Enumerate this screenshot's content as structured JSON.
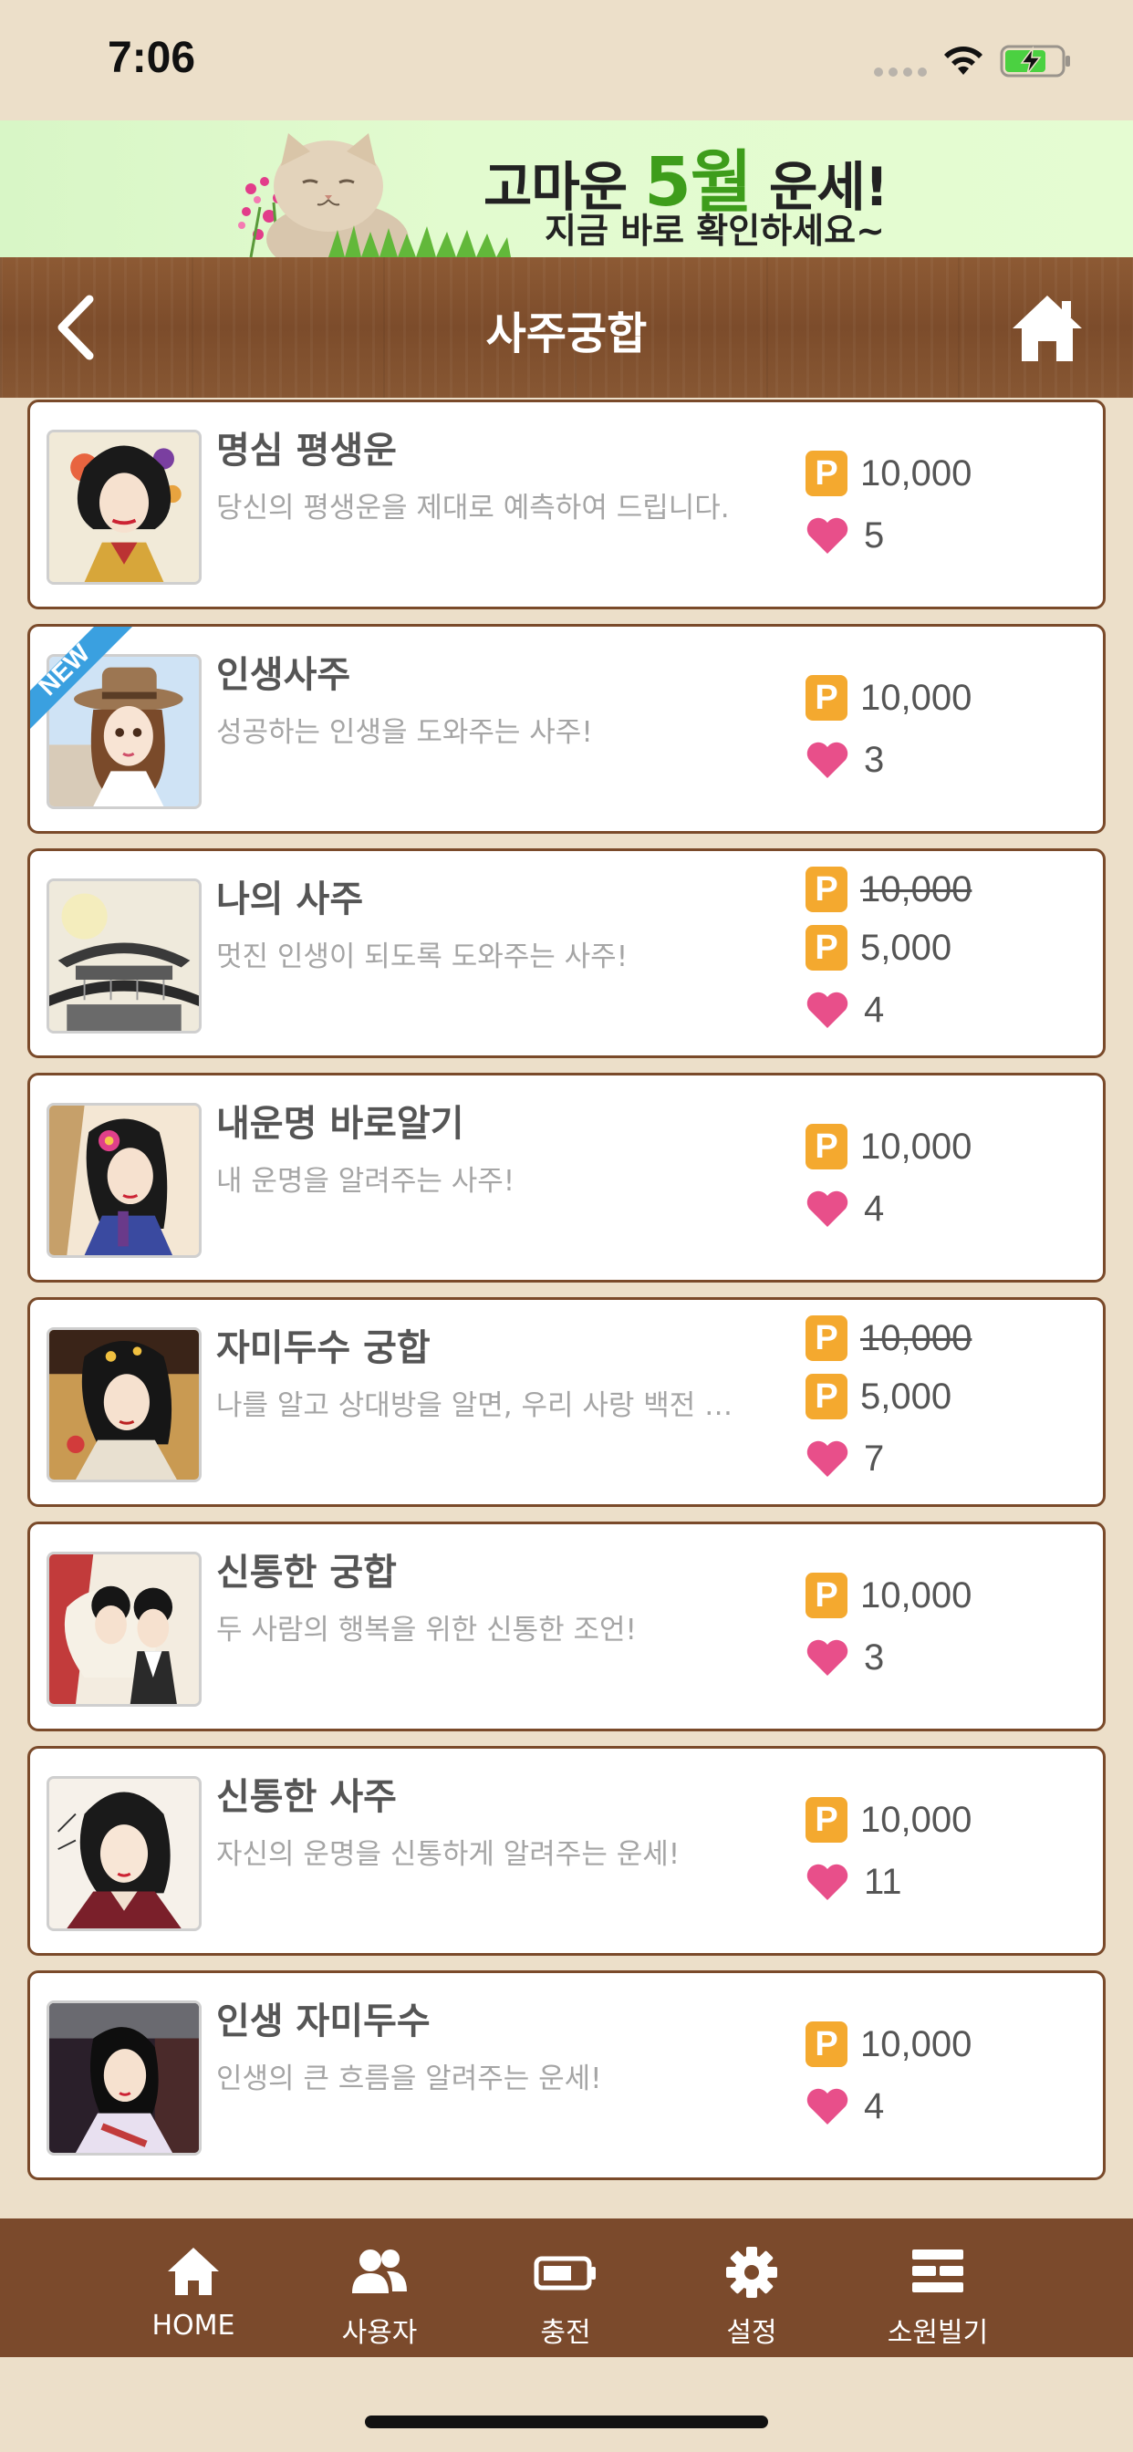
{
  "status_bar": {
    "time": "7:06"
  },
  "banner": {
    "title_prefix": "고마운 ",
    "title_highlight": "5월",
    "title_suffix": " 운세!",
    "subtitle": "지금 바로 확인하세요~"
  },
  "header": {
    "title": "사주궁합"
  },
  "items": [
    {
      "title": "명심 평생운",
      "desc": "당신의 평생운을 제대로 예측하여 드립니다.",
      "price": "10,000",
      "likes": "5",
      "art": "lady-flowers"
    },
    {
      "title": "인생사주",
      "desc": "성공하는 인생을 도와주는 사주!",
      "price": "10,000",
      "likes": "3",
      "badge": "NEW",
      "art": "girl-hat"
    },
    {
      "title": "나의 사주",
      "desc": "멋진 인생이 되도록 도와주는 사주!",
      "original_price": "10,000",
      "price": "5,000",
      "likes": "4",
      "art": "palace"
    },
    {
      "title": "내운명 바로알기",
      "desc": "내 운명을 알려주는 사주!",
      "price": "10,000",
      "likes": "4",
      "art": "lady-pink"
    },
    {
      "title": "자미두수 궁합",
      "desc": "나를 알고 상대방을 알면, 우리 사랑 백전 백승!",
      "original_price": "10,000",
      "price": "5,000",
      "likes": "7",
      "art": "lady-dark"
    },
    {
      "title": "신통한 궁합",
      "desc": "두 사람의 행복을 위한 신통한 조언!",
      "price": "10,000",
      "likes": "3",
      "art": "couple"
    },
    {
      "title": "신통한 사주",
      "desc": "자신의 운명을 신통하게 알려주는 운세!",
      "price": "10,000",
      "likes": "11",
      "art": "lady-red"
    },
    {
      "title": "인생 자미두수",
      "desc": "인생의 큰 흐름을 알려주는 운세!",
      "price": "10,000",
      "likes": "4",
      "art": "lady-night"
    }
  ],
  "price_badge": "P",
  "tabs": [
    {
      "label": "HOME",
      "icon": "home-icon"
    },
    {
      "label": "사용자",
      "icon": "users-icon"
    },
    {
      "label": "충전",
      "icon": "battery-charge-icon"
    },
    {
      "label": "설정",
      "icon": "gear-icon"
    },
    {
      "label": "소원빌기",
      "icon": "wish-icon"
    }
  ],
  "colors": {
    "background": "#ecdfc9",
    "header_wood": "#7c4c2b",
    "card_border": "#7a4a2a",
    "point_badge": "#f4a92f",
    "heart": "#e84f8a",
    "banner_green": "#3e9d1b",
    "new_ribbon": "#3aa0e0"
  }
}
